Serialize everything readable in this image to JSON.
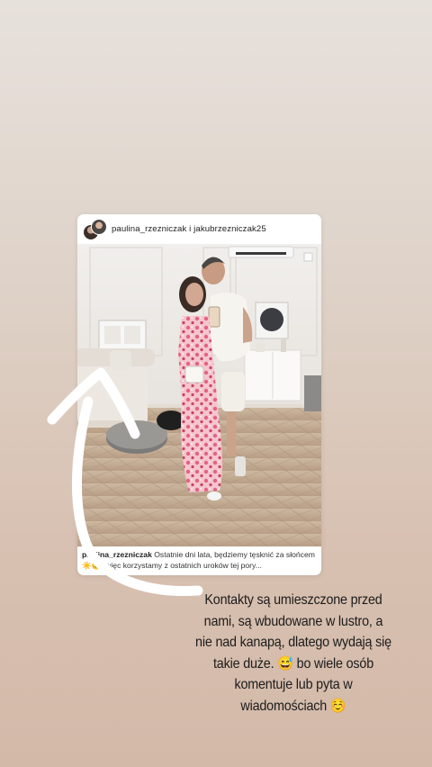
{
  "post": {
    "usernames": "paulina_rzezniczak i jakubrzezniczak25",
    "caption_user": "paulina_rzezniczak",
    "caption_text": "Ostatnie dni lata, będziemy tęsknić za słońcem ☀️😊, więc korzystamy z ostatnich uroków tej pory..."
  },
  "overlay_text": "Kontakty są umieszczone przed nami, są wbudowane w lustro, a nie nad kanapą, dlatego wydają się takie duże. 😅 bo wiele osób komentuje lub pyta w wiadomościach ☺️",
  "colors": {
    "background_top": "#e7e1dc",
    "background_bottom": "#d3b9a8",
    "arrow": "#ffffff",
    "dress": "#f2a4b8"
  },
  "icons": [
    "avatar-icon",
    "arrow-drawing"
  ]
}
